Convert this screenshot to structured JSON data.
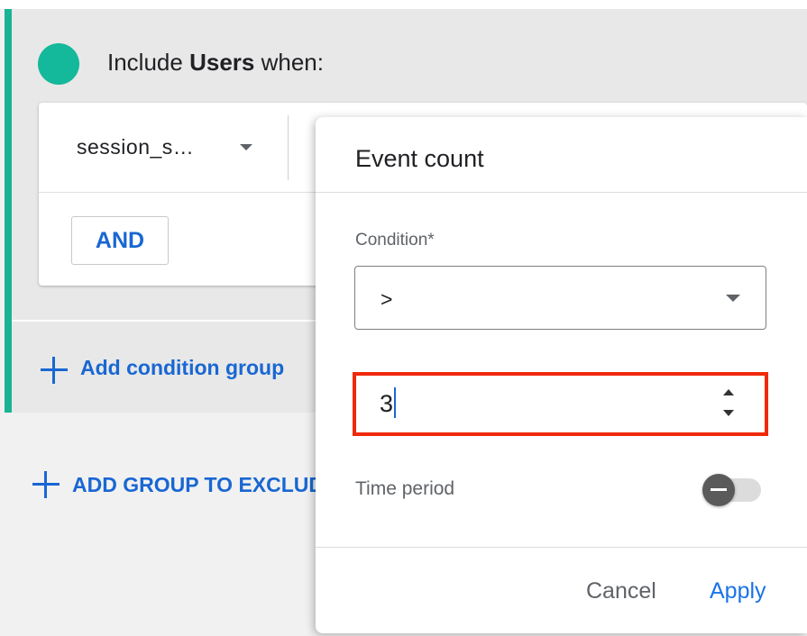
{
  "group": {
    "title_prefix": "Include ",
    "title_entity": "Users",
    "title_suffix": " when:",
    "accent_color": "#1ab394"
  },
  "condition_row": {
    "dimension_value": "session_s…",
    "and_button": "AND"
  },
  "actions": {
    "add_condition_group": "Add condition group",
    "add_group_to_exclude": "ADD GROUP TO EXCLUDE"
  },
  "popup": {
    "title": "Event count",
    "condition_label": "Condition*",
    "condition_operator": ">",
    "count_value": "3",
    "time_period_label": "Time period",
    "time_period_enabled": false,
    "cancel_label": "Cancel",
    "apply_label": "Apply"
  },
  "icons": {
    "group_indicator": "teal-circle-icon",
    "dropdown": "caret-down-icon",
    "add": "plus-icon",
    "spinner": "spinner-arrows-icon",
    "toggle_knob": "minus-icon"
  },
  "colors": {
    "link_blue": "#1967d2",
    "apply_blue": "#1a73e8",
    "highlight_red": "#f0290b",
    "teal_dot": "#14b89a"
  }
}
